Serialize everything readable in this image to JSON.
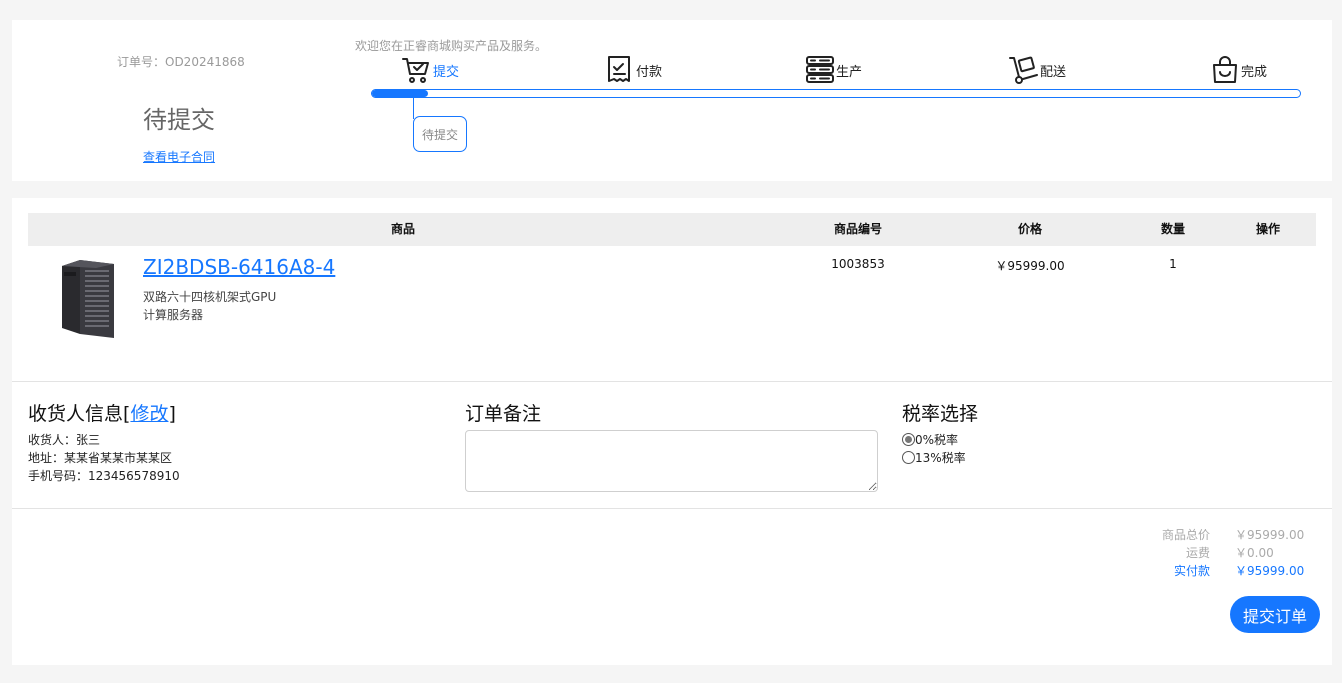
{
  "status": {
    "order_no": "订单号：OD20241868",
    "state": "待提交",
    "contract_link": "查看电子合同",
    "welcome": "欢迎您在正睿商城购买产品及服务。",
    "steps": [
      {
        "label": "提交",
        "icon": "cart-check-icon",
        "active": true
      },
      {
        "label": "付款",
        "icon": "receipt-check-icon",
        "active": false
      },
      {
        "label": "生产",
        "icon": "server-icon",
        "active": false
      },
      {
        "label": "配送",
        "icon": "hand-truck-icon",
        "active": false
      },
      {
        "label": "完成",
        "icon": "shopping-bag-icon",
        "active": false
      }
    ],
    "progress_fraction": 0.06,
    "current_tip": "待提交"
  },
  "table": {
    "headers": {
      "product": "商品",
      "code": "商品编号",
      "price": "价格",
      "qty": "数量",
      "action": "操作"
    },
    "rows": [
      {
        "name": "ZI2BDSB-6416A8-4",
        "desc_line1": "双路六十四核机架式GPU",
        "desc_line2": "计算服务器",
        "code": "1003853",
        "price": "￥95999.00",
        "qty": "1",
        "image": "tower-server-image"
      }
    ]
  },
  "receiver": {
    "title": "收货人信息",
    "edit_link": "修改",
    "name_line": "收货人：张三",
    "address_line": "地址：某某省某某市某某区",
    "phone_line": "手机号码：123456578910"
  },
  "remark": {
    "title": "订单备注",
    "value": ""
  },
  "tax": {
    "title": "税率选择",
    "options": [
      {
        "label": "0%税率",
        "checked": true
      },
      {
        "label": "13%税率",
        "checked": false
      }
    ]
  },
  "summary": {
    "goods_label": "商品总价",
    "goods_value": "￥95999.00",
    "shipping_label": "运费",
    "shipping_value": "￥0.00",
    "paid_label": "实付款",
    "paid_value": "￥95999.00"
  },
  "submit_label": "提交订单",
  "colors": {
    "accent": "#1677ff",
    "muted": "#9a9a9a"
  }
}
